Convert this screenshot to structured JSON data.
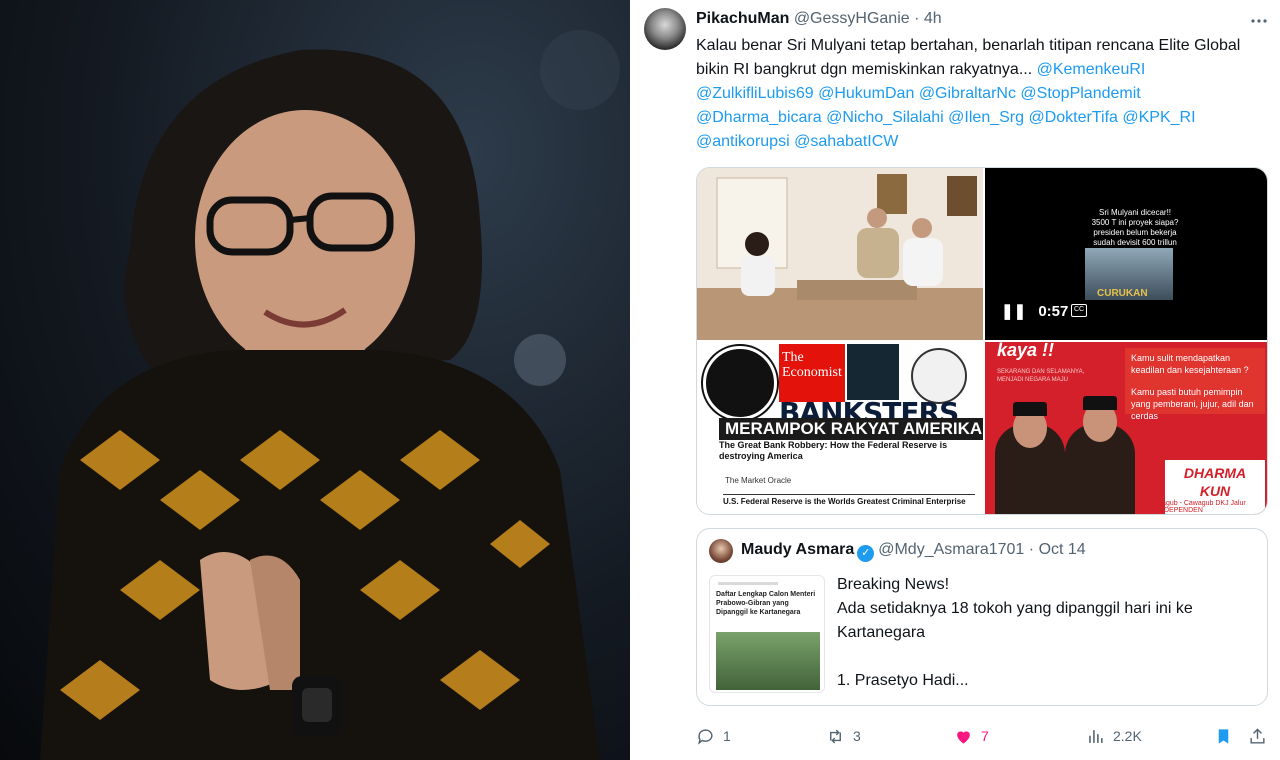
{
  "tweet": {
    "display_name": "PikachuMan",
    "handle": "@GessyHGanie",
    "separator": "·",
    "time": "4h",
    "more_icon": "more-horizontal-icon",
    "text_plain": "Kalau benar Sri Mulyani tetap bertahan, benarlah titipan rencana Elite Global bikin RI bangkrut dgn memiskinkan rakyatnya...",
    "mentions": [
      "@KemenkeuRI",
      "@ZulkifliLubis69",
      "@HukumDan",
      "@GibraltarNc",
      "@StopPlandemit",
      "@Dharma_bicara",
      "@Nicho_Silalahi",
      "@Ilen_Srg",
      "@DokterTifa",
      "@KPK_RI",
      "@antikorupsi",
      "@sahabatICW"
    ]
  },
  "media": {
    "video": {
      "overlay_text": "Sri Mulyani dicecar!! 3500 T ini proyek siapa? presiden belum bekerja sudah devisit 600 trillun",
      "caption": "CURUKAN",
      "duration": "0:57",
      "pause_icon": "pause-icon",
      "cc_label": "CC"
    },
    "collage": {
      "economist_label": "The Economist",
      "banksters": "BANKSTERS",
      "banner": "MERAMPOK RAKYAT AMERIKA",
      "headline": "The Great Bank Robbery: How the Federal Reserve is destroying America",
      "source": "The Market Oracle",
      "footer": "U.S. Federal Reserve is the Worlds Greatest Criminal Enterprise"
    },
    "campaign": {
      "kaya": "kaya !!",
      "tagline": "SEKARANG DAN SELAMANYA, MENJADI NEGARA MAJU",
      "q1": "Kamu sulit mendapatkan keadilan dan kesejahteraan ?",
      "q2": "Kamu pasti butuh pemimpin yang pemberani, jujur, adil dan cerdas",
      "dharma": "DHARMA",
      "kun": "KUN",
      "cagub": "Cagub - Cawagub DKJ Jalur INDEPENDEN"
    }
  },
  "quote": {
    "display_name": "Maudy Asmara",
    "verified_icon": "verified-badge-icon",
    "handle": "@Mdy_Asmara1701",
    "separator": "·",
    "time": "Oct 14",
    "thumb_title": "Daftar Lengkap Calon Menteri Prabowo-Gibran yang Dipanggil ke Kartanegara",
    "line1": "Breaking News!",
    "line2": "Ada setidaknya 18 tokoh yang dipanggil hari ini ke Kartanegara",
    "line3": "1. Prasetyo Hadi..."
  },
  "actions": {
    "reply_count": "1",
    "retweet_count": "3",
    "like_count": "7",
    "views_count": "2.2K",
    "like_color": "#f91880",
    "bookmark_color": "#1d9bf0"
  },
  "colors": {
    "link": "#1d9bf0",
    "secondary_text": "#536471",
    "border": "#cfd9de"
  }
}
